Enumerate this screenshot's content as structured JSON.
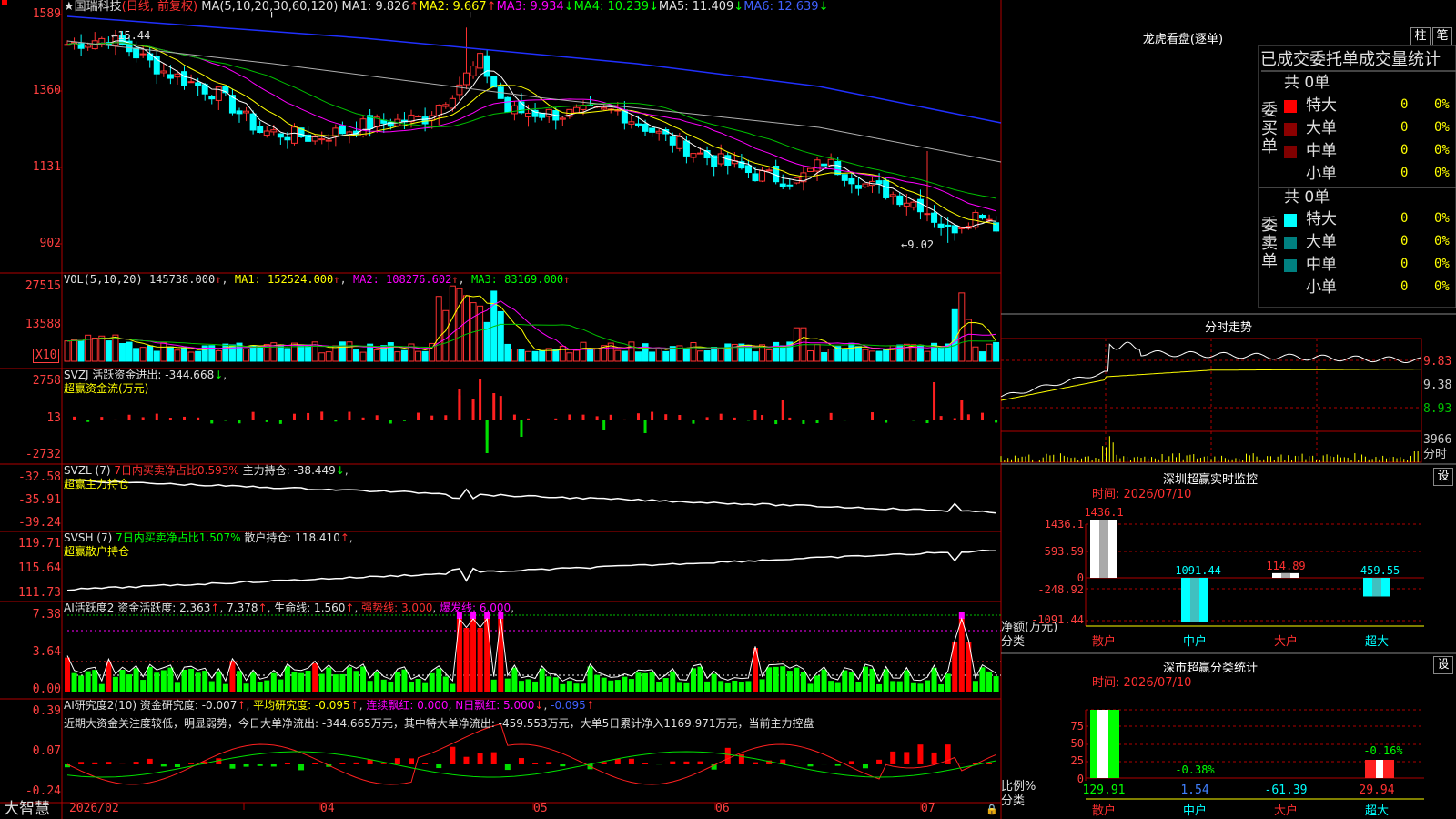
{
  "header": {
    "star": "★",
    "stock_name": "国瑞科技",
    "period_label": "(日线, 前复权)",
    "ma_def": "MA(5,10,20,30,60,120)",
    "ma1": "MA1: 9.826",
    "ma2": "MA2: 9.667",
    "ma3": "MA3: 9.934",
    "ma4": "MA4: 10.239",
    "ma5": "MA5: 11.409",
    "ma6": "MA6: 12.639"
  },
  "price_axis": [
    "1589",
    "1360",
    "1131",
    "902"
  ],
  "price_annotations": {
    "high": "15.44",
    "low": "9.02"
  },
  "vol": {
    "def": "VOL(5,10,20)",
    "value": "145738.000",
    "ma1": "MA1: 152524.000",
    "ma2": "MA2: 108276.602",
    "ma3": "MA3: 83169.000",
    "axis": [
      "27515",
      "13588"
    ],
    "unit": "X10"
  },
  "svzj": {
    "line1": "SVZJ  活跃资金进出: -344.668",
    "line2": "超赢资金流(万元)",
    "axis": [
      "2758",
      "13",
      "-2732"
    ]
  },
  "svzl": {
    "def": "SVZL (7)",
    "ratio": "7日内买卖净占比0.593%",
    "main": "主力持仓: -38.449",
    "line2": "超赢主力持仓",
    "axis": [
      "-32.58",
      "-35.91",
      "-39.24"
    ]
  },
  "svsh": {
    "def": "SVSH (7)",
    "ratio": "7日内买卖净占比1.507%",
    "retail": "散户持仓: 118.410",
    "line2": "超赢散户持仓",
    "axis": [
      "119.71",
      "115.64",
      "111.73"
    ]
  },
  "ai_active": {
    "def": "AI活跃度2",
    "active": "资金活跃度: 2.363",
    "v2": "7.378",
    "life": "生命线: 1.560",
    "strong": "强势线: 3.000",
    "burst": "爆发线: 6.000",
    "axis": [
      "7.38",
      "3.64",
      "0.00"
    ]
  },
  "ai_research": {
    "def": "AI研究度2(10)",
    "research": "资金研究度: -0.007",
    "avg": "平均研究度: -0.095",
    "lian": "连续飘红: 0.000",
    "nday": "N日飘红: 5.000",
    "last": "-0.095",
    "comment": "近期大资金关注度较低，明显弱势，今日大单净流出: -344.665万元，其中特大单净流出: -459.553万元，大单5日累计净入1169.971万元，当前主力控盘",
    "axis": [
      "0.39",
      "0.07",
      "-0.24"
    ]
  },
  "date_axis": [
    "2026/02",
    "04",
    "05",
    "06",
    "07"
  ],
  "brand": "大智慧",
  "right": {
    "dragon_title": "龙虎看盘(逐单)",
    "btn_zhu": "柱",
    "btn_bi": "笔",
    "stat_header": "已成交委托单成交量统计",
    "buy_label": [
      "委",
      "买",
      "单"
    ],
    "sell_label": [
      "委",
      "卖",
      "单"
    ],
    "buy_total": "共 0单",
    "sell_total": "共 0单",
    "buy_rows": [
      {
        "name": "特大",
        "count": "0",
        "pct": "0%",
        "color": "#ff0000"
      },
      {
        "name": "大单",
        "count": "0",
        "pct": "0%",
        "color": "#8b0000"
      },
      {
        "name": "中单",
        "count": "0",
        "pct": "0%",
        "color": "#800000"
      },
      {
        "name": "小单",
        "count": "0",
        "pct": "0%",
        "color": ""
      }
    ],
    "sell_rows": [
      {
        "name": "特大",
        "count": "0",
        "pct": "0%",
        "color": "#00ffff"
      },
      {
        "name": "大单",
        "count": "0",
        "pct": "0%",
        "color": "#008080"
      },
      {
        "name": "中单",
        "count": "0",
        "pct": "0%",
        "color": "#008080"
      },
      {
        "name": "小单",
        "count": "0",
        "pct": "0%",
        "color": ""
      }
    ],
    "intraday_title": "分时走势",
    "intraday_axis": [
      "9.83",
      "9.38",
      "8.93"
    ],
    "intraday_vol": "3966",
    "intraday_label": "分时",
    "monitor_title": "深圳超赢实时监控",
    "monitor_btn": "设",
    "monitor_time": "时间: 2026/07/10",
    "monitor_axis": [
      "1436.1",
      "593.59",
      "0",
      "-248.92",
      "-1091.44"
    ],
    "monitor_values": [
      "1436.1",
      "-1091.44",
      "114.89",
      "-459.55"
    ],
    "monitor_ylabel": "净额(万元)",
    "monitor_xlabel": "分类",
    "categories": [
      "散户",
      "中户",
      "大户",
      "超大"
    ],
    "classify_title": "深市超赢分类统计",
    "classify_btn": "设",
    "classify_time": "时间: 2026/07/10",
    "classify_axis": [
      "75",
      "50",
      "25",
      "0"
    ],
    "classify_pcts": [
      "-0.38%",
      "-0.16%"
    ],
    "classify_values": [
      "129.91",
      "1.54",
      "-61.39",
      "29.94"
    ],
    "classify_ylabel": "比例%",
    "classify_xlabel": "分类"
  },
  "chart_data": {
    "type": "candlestick",
    "price_range": [
      9.02,
      15.89
    ],
    "high": 15.44,
    "low": 9.02,
    "monitor": {
      "categories": [
        "散户",
        "中户",
        "大户",
        "超大"
      ],
      "values": [
        1436.1,
        -1091.44,
        114.89,
        -459.55
      ]
    },
    "classify": {
      "categories": [
        "散户",
        "中户",
        "大户",
        "超大"
      ],
      "values": [
        129.91,
        1.54,
        -61.39,
        29.94
      ]
    }
  }
}
